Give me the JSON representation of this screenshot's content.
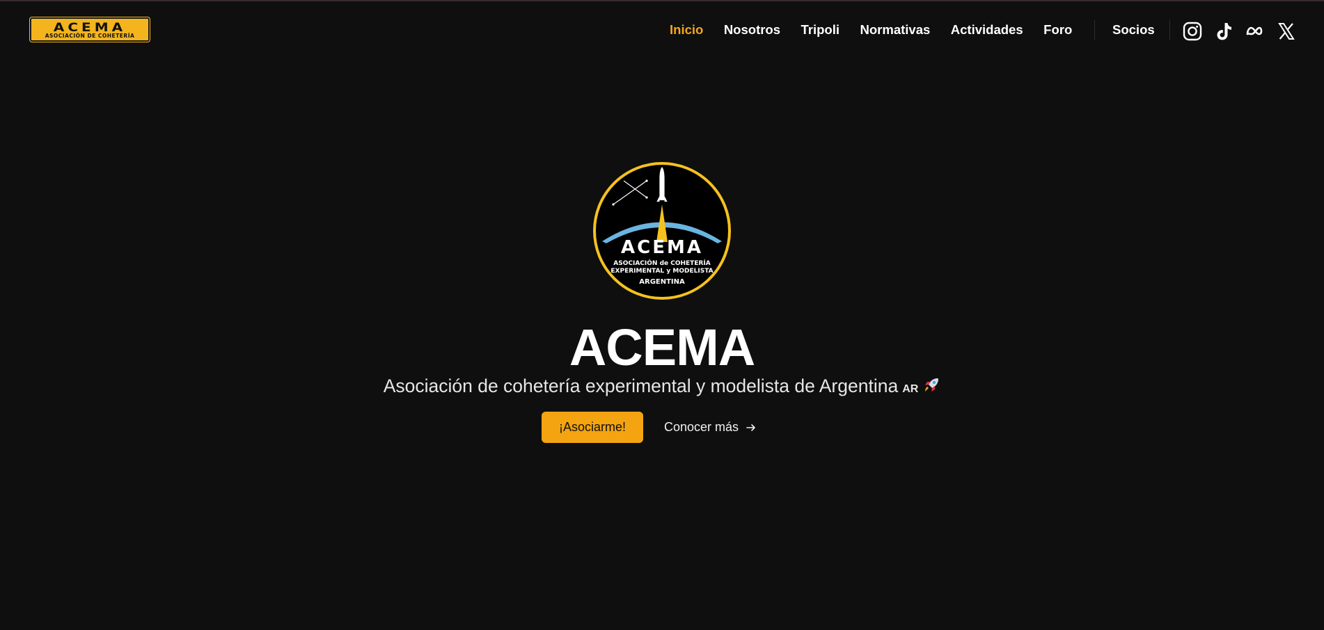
{
  "header": {
    "logo": {
      "mark_text": "ACEMA",
      "subtitle": "ASOCIACIÓN DE COHETERÍA",
      "background_color": "#f3b41d"
    },
    "nav": [
      {
        "label": "Inicio",
        "active": true
      },
      {
        "label": "Nosotros",
        "active": false
      },
      {
        "label": "Tripoli",
        "active": false
      },
      {
        "label": "Normativas",
        "active": false
      },
      {
        "label": "Actividades",
        "active": false
      },
      {
        "label": "Foro",
        "active": false
      }
    ],
    "socios_label": "Socios",
    "social_icons": [
      "instagram-icon",
      "tiktok-icon",
      "meta-icon",
      "x-icon"
    ]
  },
  "hero": {
    "emblem": {
      "logo_text": "ACEMA",
      "line1": "ASOCIACIÓN de COHETERÍA",
      "line2": "EXPERIMENTAL y MODELISTA",
      "line3": "ARGENTINA"
    },
    "title": "ACEMA",
    "subtitle": "Asociación de cohetería experimental y modelista de Argentina",
    "flag_code": "AR",
    "subtitle_emoji": "rocket-icon",
    "primary_button": "¡Asociarme!",
    "secondary_button": "Conocer más"
  },
  "colors": {
    "background": "#0f0f10",
    "accent": "#f3a410",
    "active_nav": "#f3a81a",
    "text": "#ffffff"
  }
}
